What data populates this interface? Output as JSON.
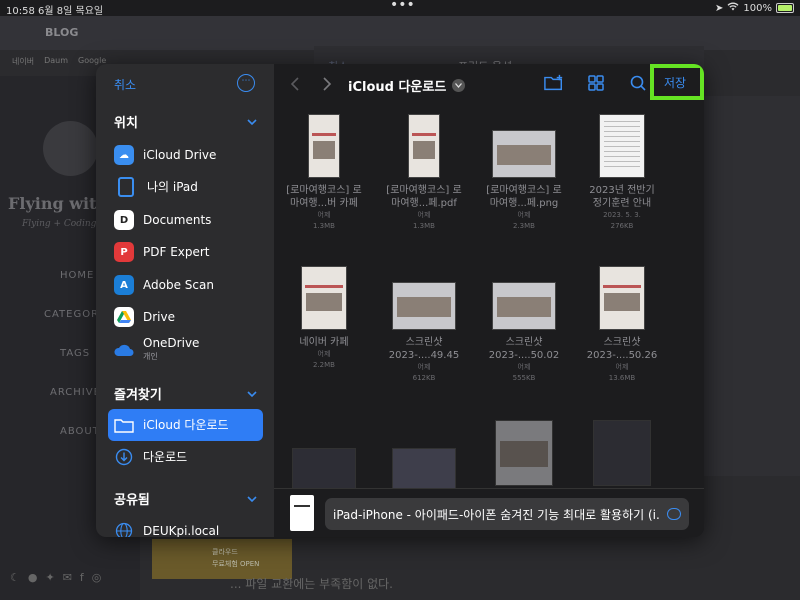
{
  "status": {
    "time": "10:58",
    "date": "6월 8일 목요일",
    "battery": "100%"
  },
  "background": {
    "blog_title": "BLOG",
    "tabs": [
      "네이버",
      "Daum",
      "Google"
    ],
    "heading": "Flying with",
    "subheading": "Flying + Coding",
    "nav": [
      "HOME",
      "CATEGORY",
      "TAGS",
      "ARCHIVE",
      "ABOUT"
    ],
    "cancel": "취소",
    "print_options": "프린트 옵션",
    "footer_text": "... 파일 교환에는 부족함이 없다.",
    "banner_line1": "클라우드",
    "banner_line2": "무료체험 OPEN"
  },
  "sidebar": {
    "cancel_label": "취소",
    "more_label": "⋯",
    "sections": {
      "locations": "위치",
      "favorites": "즐겨찾기",
      "shared": "공유됨"
    },
    "locations": [
      {
        "label": "iCloud Drive",
        "icon": "icloud-icon",
        "color": "#3a8ef0"
      },
      {
        "label": "나의 iPad",
        "icon": "ipad-icon",
        "color": "#3a8ef0"
      },
      {
        "label": "Documents",
        "icon": "documents-icon",
        "color": "#ffffff"
      },
      {
        "label": "PDF Expert",
        "icon": "pdf-expert-icon",
        "color": "#e2393a"
      },
      {
        "label": "Adobe Scan",
        "icon": "adobe-scan-icon",
        "color": "#1b7ed6"
      },
      {
        "label": "Drive",
        "icon": "google-drive-icon",
        "color": "#ffffff"
      },
      {
        "label": "OneDrive",
        "sub": "개인",
        "icon": "onedrive-icon",
        "color": "#2a7be4"
      }
    ],
    "favorites": [
      {
        "label": "iCloud 다운로드",
        "icon": "folder-icon",
        "selected": true
      },
      {
        "label": "다운로드",
        "icon": "download-icon",
        "selected": false
      }
    ],
    "shared": [
      {
        "label": "DEUKpi.local",
        "icon": "network-icon"
      }
    ]
  },
  "toolbar": {
    "folder_title": "iCloud 다운로드",
    "save_label": "저장"
  },
  "files": [
    {
      "line1": "[로마여행코스] 로",
      "line2": "마여행...버 카페",
      "date": "어제",
      "size": "1.3MB",
      "kind": "p"
    },
    {
      "line1": "[로마여행코스] 로",
      "line2": "마여행...페.pdf",
      "date": "어제",
      "size": "1.3MB",
      "kind": "p"
    },
    {
      "line1": "[로마여행코스] 로",
      "line2": "마여행...페.png",
      "date": "어제",
      "size": "2.3MB",
      "kind": "w"
    },
    {
      "line1": "2023년 전반기",
      "line2": "정기훈련 안내",
      "date": "2023. 5. 3.",
      "size": "276KB",
      "kind": "doc"
    },
    {
      "line1": "네이버 카페",
      "line2": "",
      "date": "어제",
      "size": "2.2MB",
      "kind": "p"
    },
    {
      "line1": "스크린샷",
      "line2": "2023-....49.45",
      "date": "어제",
      "size": "612KB",
      "kind": "w"
    },
    {
      "line1": "스크린샷",
      "line2": "2023-....50.02",
      "date": "어제",
      "size": "555KB",
      "kind": "w"
    },
    {
      "line1": "스크린샷",
      "line2": "2023-....50.26",
      "date": "어제",
      "size": "13.6MB",
      "kind": "p"
    }
  ],
  "filename": {
    "value": "iPad-iPhone - 아이패드-아이폰 숨겨진 기능 최대로 활용하기 (i..."
  }
}
